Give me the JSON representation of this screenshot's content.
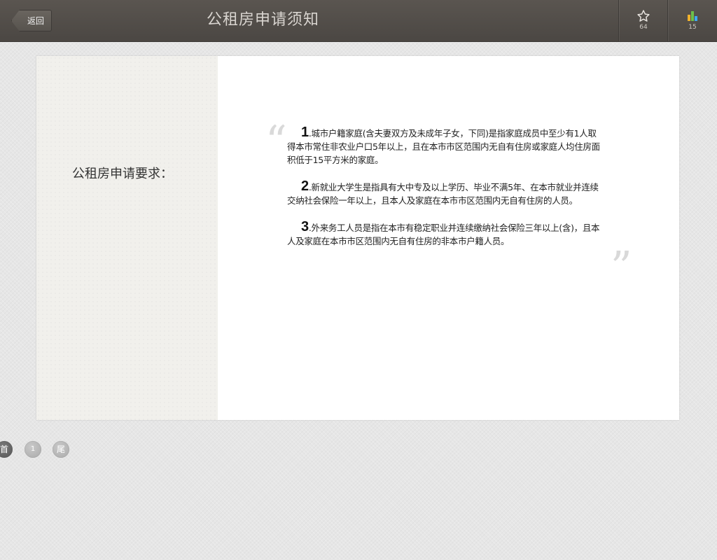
{
  "header": {
    "back_label": "返回",
    "title": "公租房申请须知",
    "favorite_count": "64",
    "stats_count": "15"
  },
  "content": {
    "heading": "公租房申请要求：",
    "requirements": [
      {
        "number": "1",
        "text": ".城市户籍家庭(含夫妻双方及未成年子女，下同)是指家庭成员中至少有1人取得本市常住非农业户口5年以上，且在本市市区范围内无自有住房或家庭人均住房面积低于15平方米的家庭。"
      },
      {
        "number": "2",
        "text": ".新就业大学生是指具有大中专及以上学历、毕业不满5年、在本市就业并连续交纳社会保险一年以上，且本人及家庭在本市市区范围内无自有住房的人员。"
      },
      {
        "number": "3",
        "text": ".外来务工人员是指在本市有稳定职业并连续缴纳社会保险三年以上(含)，且本人及家庭在本市市区范围内无自有住房的非本市户籍人员。"
      }
    ],
    "quote_open": "“",
    "quote_close": "”"
  },
  "pager": {
    "first_label": "首",
    "page_label": "1",
    "last_label": "尾"
  },
  "colors": {
    "topbar": "#504c48",
    "background": "#e6e6e6",
    "card_left": "#f1f0ec",
    "stats_icon": [
      "#f0b12c",
      "#6cc04a",
      "#3fa9f5"
    ]
  }
}
